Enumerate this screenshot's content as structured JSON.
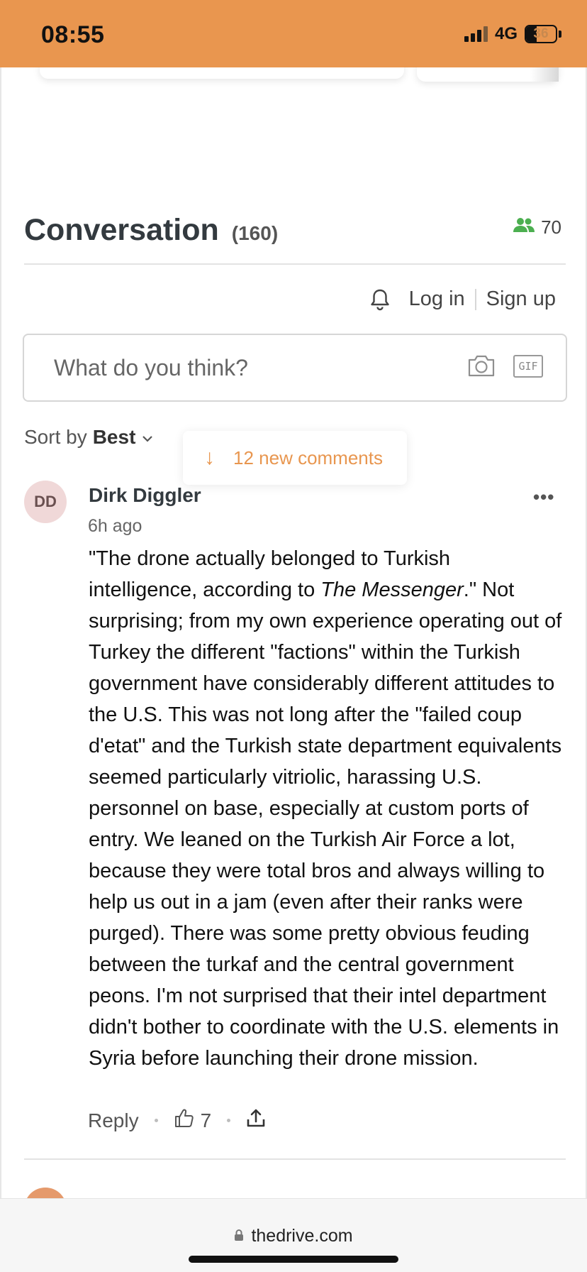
{
  "status": {
    "time": "08:55",
    "network": "4G",
    "battery_percent": "36"
  },
  "conversation": {
    "title": "Conversation",
    "count": "(160)",
    "online_count": "70"
  },
  "auth": {
    "login": "Log in",
    "signup": "Sign up"
  },
  "composer": {
    "placeholder": "What do you think?",
    "gif_label": "GIF"
  },
  "sort": {
    "prefix": "Sort by",
    "value": "Best"
  },
  "new_comments": {
    "label": "12 new comments"
  },
  "comment": {
    "avatar_initials": "DD",
    "author": "Dirk Diggler",
    "time_ago": "6h ago",
    "body_before_italic": "\"The drone actually belonged to Turkish intelligence, according to ",
    "body_italic": "The Messenger",
    "body_after_italic": ".\" Not surprising; from my own experience operating out of Turkey the different \"factions\" within the Turkish government have considerably different attitudes to the U.S. This was not long after the \"failed coup d'etat\" and the Turkish state department equivalents seemed particularly vitriolic, harassing U.S. personnel on base, especially at custom ports of entry. We leaned on the Turkish Air Force a lot, because they were total bros and always willing to help us out in a jam (even after their ranks were purged). There was some pretty obvious feuding between the turkaf and the central government peons. I'm not surprised that their intel department didn't bother to coordinate with the U.S. elements in Syria before launching their drone mission.",
    "reply_label": "Reply",
    "likes": "7"
  },
  "browser": {
    "url": "thedrive.com"
  },
  "colors": {
    "status_bar": "#e9964f",
    "accent": "#e8964f",
    "online_icon": "#4caf50"
  }
}
